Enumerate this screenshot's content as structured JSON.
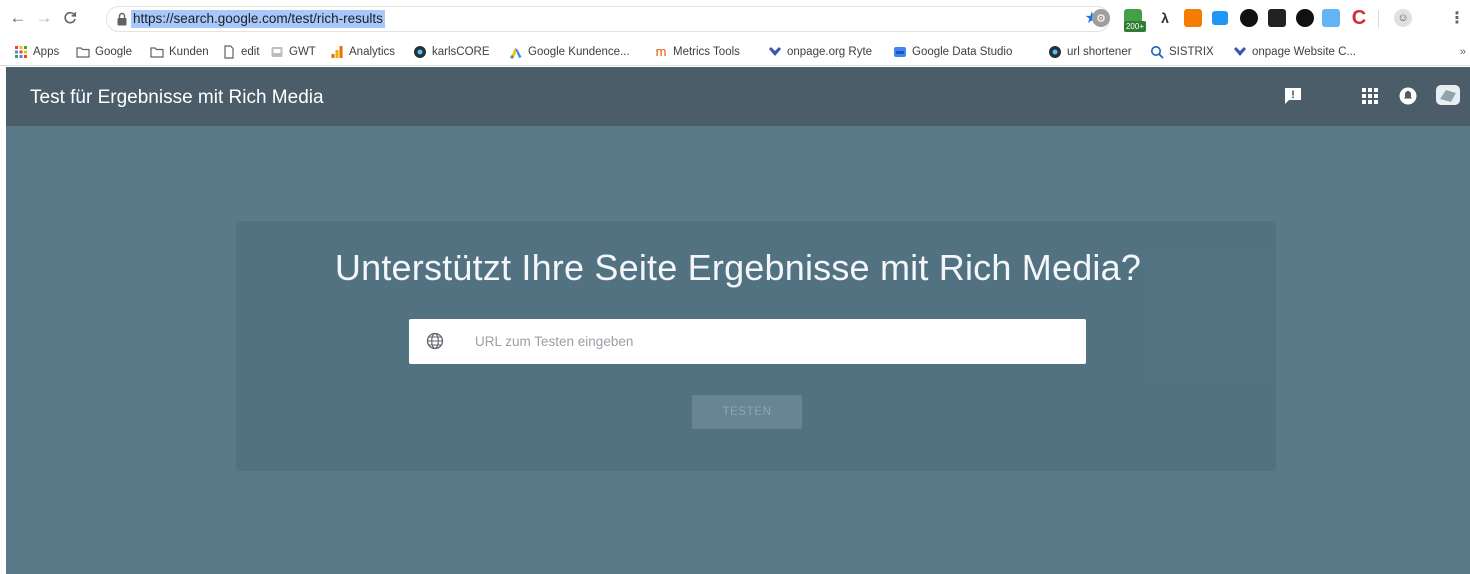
{
  "browser": {
    "url": "https://search.google.com/test/rich-results",
    "extension_badge": "200+"
  },
  "bookmarks": [
    {
      "label": "Apps",
      "icon": "apps-grid-icon"
    },
    {
      "label": "Google",
      "icon": "folder-icon"
    },
    {
      "label": "Kunden",
      "icon": "folder-icon"
    },
    {
      "label": "edit",
      "icon": "page-icon"
    },
    {
      "label": "GWT",
      "icon": "gwt-icon"
    },
    {
      "label": "Analytics",
      "icon": "analytics-icon"
    },
    {
      "label": "karlsCORE",
      "icon": "globe-icon"
    },
    {
      "label": "Google Kundence...",
      "icon": "google-ads-icon"
    },
    {
      "label": "Metrics Tools",
      "icon": "metrics-icon"
    },
    {
      "label": "onpage.org Ryte",
      "icon": "ryte-icon"
    },
    {
      "label": "Google Data Studio",
      "icon": "data-studio-icon"
    },
    {
      "label": "url shortener",
      "icon": "globe-icon"
    },
    {
      "label": "SISTRIX",
      "icon": "search-icon"
    },
    {
      "label": "onpage Website C...",
      "icon": "ryte-icon"
    }
  ],
  "bookmarks_overflow": "»",
  "app": {
    "title": "Test für Ergebnisse mit Rich Media"
  },
  "main": {
    "headline": "Unterstützt Ihre Seite Ergebnisse mit Rich Media?",
    "search_placeholder": "URL zum Testen eingeben",
    "test_button": "TESTEN"
  },
  "colors": {
    "header_bg": "#4a5d68",
    "main_bg": "#5a7a8a",
    "url_highlight": "#a8c7fa"
  }
}
